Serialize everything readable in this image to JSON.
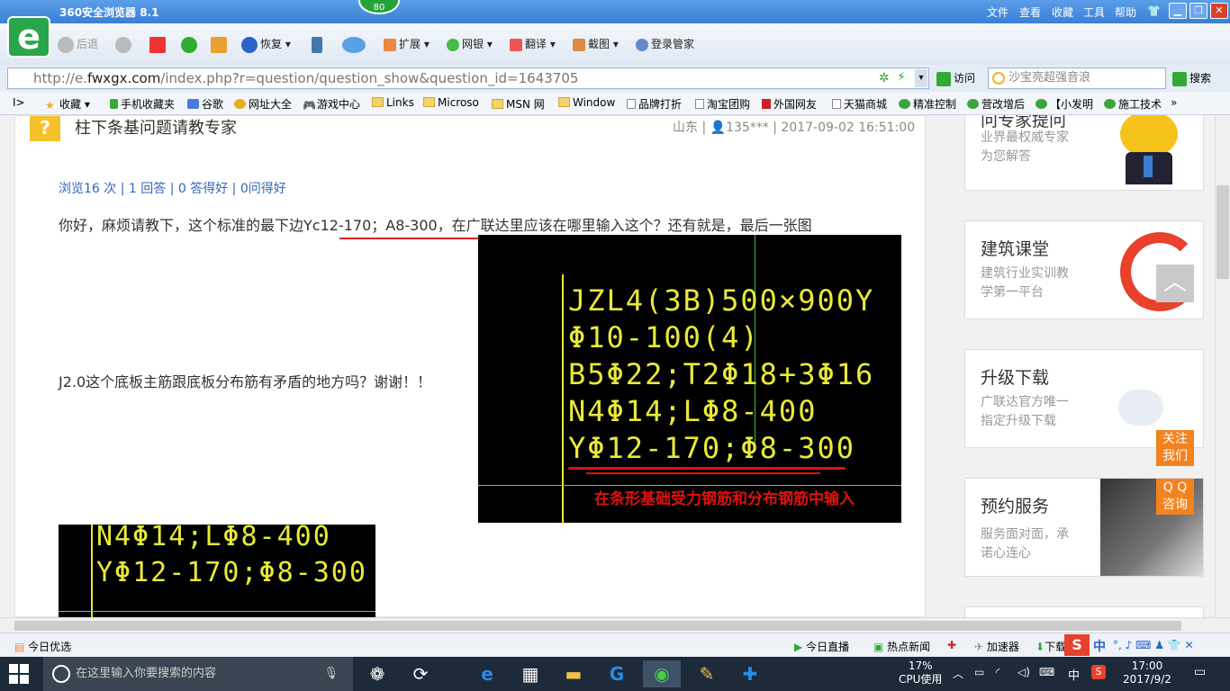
{
  "browser": {
    "title": "360安全浏览器 8.1",
    "speed_badge": "80",
    "menu": [
      "文件",
      "查看",
      "收藏",
      "工具",
      "帮助"
    ],
    "back": "后退",
    "restore": "恢复",
    "extend": "扩展",
    "netbank": "网银",
    "translate": "翻译",
    "screenshot": "截图",
    "login": "登录管家",
    "url_prefix": "http://e.",
    "url_domain": "fwxgx.com",
    "url_path": "/index.php?r=question/question_show&question_id=1643705",
    "visit": "访问",
    "search_placeholder": "沙宝亮超强音浪",
    "search_btn": "搜索"
  },
  "bookmarks": [
    "收藏",
    "手机收藏夹",
    "谷歌",
    "网址大全",
    "游戏中心",
    "Links",
    "Microso",
    "MSN 网",
    "Window",
    "品牌打折",
    "淘宝团购",
    "外国网友",
    "天猫商城",
    "精准控制",
    "营改增后",
    "【小发明",
    "施工技术"
  ],
  "question": {
    "title": "柱下条基问题请教专家",
    "region": "山东",
    "user": "135***",
    "time": "2017-09-02 16:51:00",
    "stats": "浏览16 次 | 1 回答 | 0 答得好 | 0问得好",
    "para1": "你好，麻烦请教下，这个标准的最下边Yc12-170；A8-300，在广联达里应该在哪里输入这个？还有就是，最后一张图",
    "para2": "J2.0这个底板主筋跟底板分布筋有矛盾的地方吗？谢谢！！",
    "cad_lines": [
      "JZL4(3B)500×900Y",
      "Φ10-100(4)",
      "B5Φ22;T2Φ18+3Φ16",
      "N4Φ14;LΦ8-400",
      "YΦ12-170;Φ8-300"
    ],
    "note": "在条形基础受力钢筋和分布钢筋中输入",
    "cad2_lines": [
      "N4Φ14;LΦ8-400",
      "YΦ12-170;Φ8-300"
    ]
  },
  "sidebar": [
    {
      "title": "问专家提问",
      "desc": [
        "业界最权威专家",
        "为您解答"
      ]
    },
    {
      "title": "建筑课堂",
      "desc": [
        "建筑行业实训教",
        "学第一平台"
      ]
    },
    {
      "title": "升级下载",
      "desc": [
        "广联达官方唯一",
        "指定升级下载"
      ]
    },
    {
      "title": "预约服务",
      "desc": [
        "服务面对面，承",
        "诺心连心"
      ]
    }
  ],
  "float": {
    "follow": [
      "关注",
      "我们"
    ],
    "qq": [
      "Q Q",
      "咨询"
    ]
  },
  "statusbar": {
    "left": "今日优选",
    "live": "今日直播",
    "news": "热点新闻",
    "accel": "加速器",
    "download": "下载",
    "ime": "中"
  },
  "taskbar": {
    "search": "在这里输入你要搜索的内容",
    "cpu": "17%",
    "cpu_label": "CPU使用",
    "ime": "中",
    "time": "17:00",
    "date": "2017/9/2"
  }
}
